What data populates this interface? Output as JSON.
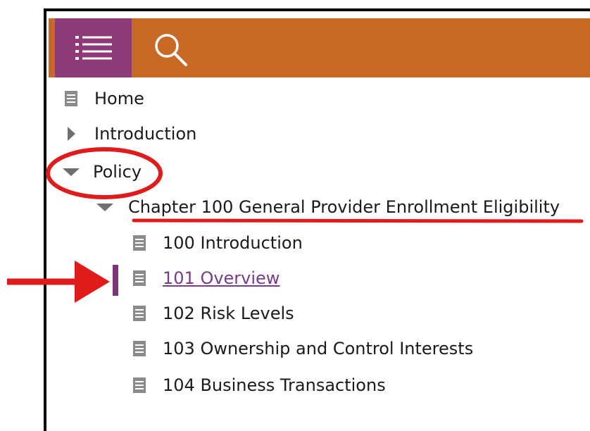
{
  "toolbar": {
    "menu_icon": "hamburger-list-icon",
    "search_icon": "search-icon"
  },
  "colors": {
    "topbar": "#c86a25",
    "menu_button": "#8e3a77",
    "selected_link": "#7a3b8a",
    "annotation_red": "#e01b1b"
  },
  "nav": {
    "home": "Home",
    "introduction": "Introduction",
    "policy": "Policy",
    "chapter": "Chapter 100 General Provider Enrollment Eligibility",
    "items": [
      "100 Introduction",
      "101 Overview",
      "102 Risk Levels",
      "103 Ownership and Control Interests",
      "104 Business Transactions"
    ]
  }
}
